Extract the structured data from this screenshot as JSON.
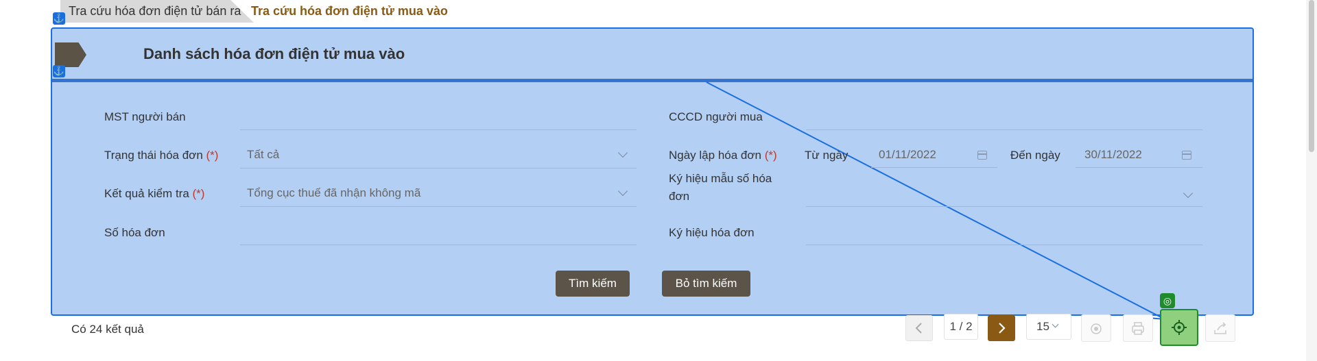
{
  "tabs": {
    "sold": "Tra cứu hóa đơn điện tử bán ra",
    "purchased": "Tra cứu hóa đơn điện tử mua vào"
  },
  "panel": {
    "title": "Danh sách hóa đơn điện tử mua vào"
  },
  "form": {
    "seller_tax_label": "MST người bán",
    "buyer_id_label": "CCCD người mua",
    "status_label": "Trạng thái hóa đơn",
    "status_value": "Tất cả",
    "date_label": "Ngày lập hóa đơn",
    "from_label": "Từ ngày",
    "from_value": "01/11/2022",
    "to_label": "Đến ngày",
    "to_value": "30/11/2022",
    "check_label": "Kết quả kiểm tra",
    "check_value": "Tổng cục thuế đã nhận không mã",
    "template_label": "Ký hiệu mẫu số hóa đơn",
    "number_label": "Số hóa đơn",
    "symbol_label": "Ký hiệu hóa đơn",
    "required_mark": "(*)"
  },
  "actions": {
    "search": "Tìm kiếm",
    "clear": "Bỏ tìm kiếm"
  },
  "footer": {
    "result_count": "Có 24 kết quả",
    "page": "1 / 2",
    "page_size": "15"
  },
  "icons": {
    "prev": "chevron-left-icon",
    "next": "chevron-right-icon",
    "view": "eye-icon",
    "print": "printer-icon",
    "locate": "target-icon",
    "export": "export-icon",
    "anchor": "anchor-icon"
  },
  "colors": {
    "accent": "#8a5a14",
    "selection_blue": "#1a6fe0",
    "highlight_green": "#1f8b2a",
    "button_dark": "#5c5449"
  }
}
